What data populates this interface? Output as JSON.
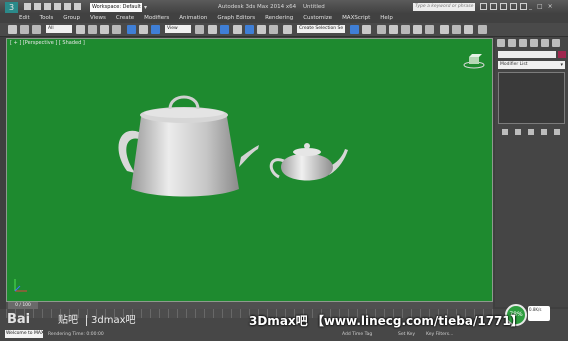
{
  "window": {
    "workspace": "Workspace: Default",
    "app_title": "Autodesk 3ds Max  2014 x64",
    "doc_title": "Untitled",
    "search_placeholder": "Type a keyword or phrase",
    "controls": [
      "_",
      "□",
      "×"
    ]
  },
  "menu": [
    "Edit",
    "Tools",
    "Group",
    "Views",
    "Create",
    "Modifiers",
    "Animation",
    "Graph Editors",
    "Rendering",
    "Customize",
    "MAXScript",
    "Help"
  ],
  "toolbar": {
    "selection_filter": "All",
    "view_dropdown": "View",
    "named_selection": "Create Selection Se"
  },
  "viewport": {
    "label": "[ + ] [Perspective ] [ Shaded ]",
    "background": "#1e8a2f"
  },
  "command_panel": {
    "modifier_list": "Modifier List",
    "swatch_color": "#a0284f"
  },
  "timeline": {
    "frame_counter": "0 / 100"
  },
  "status": {
    "welcome": "Welcome to MAX",
    "render_time": "Rendering Time: 0:00:00",
    "add_time_tag": "Add Time Tag",
    "set_key": "Set Key",
    "key_filters": "Key Filters..."
  },
  "overlay": {
    "net_percent": "78%",
    "net_speed": "0.8K/s",
    "baidu_logo": "Bai",
    "tieba_label": "贴吧",
    "forum_name": "3dmax吧",
    "site_watermark": "3Dmax吧 【www.linecg.com/tieba/1771】"
  }
}
